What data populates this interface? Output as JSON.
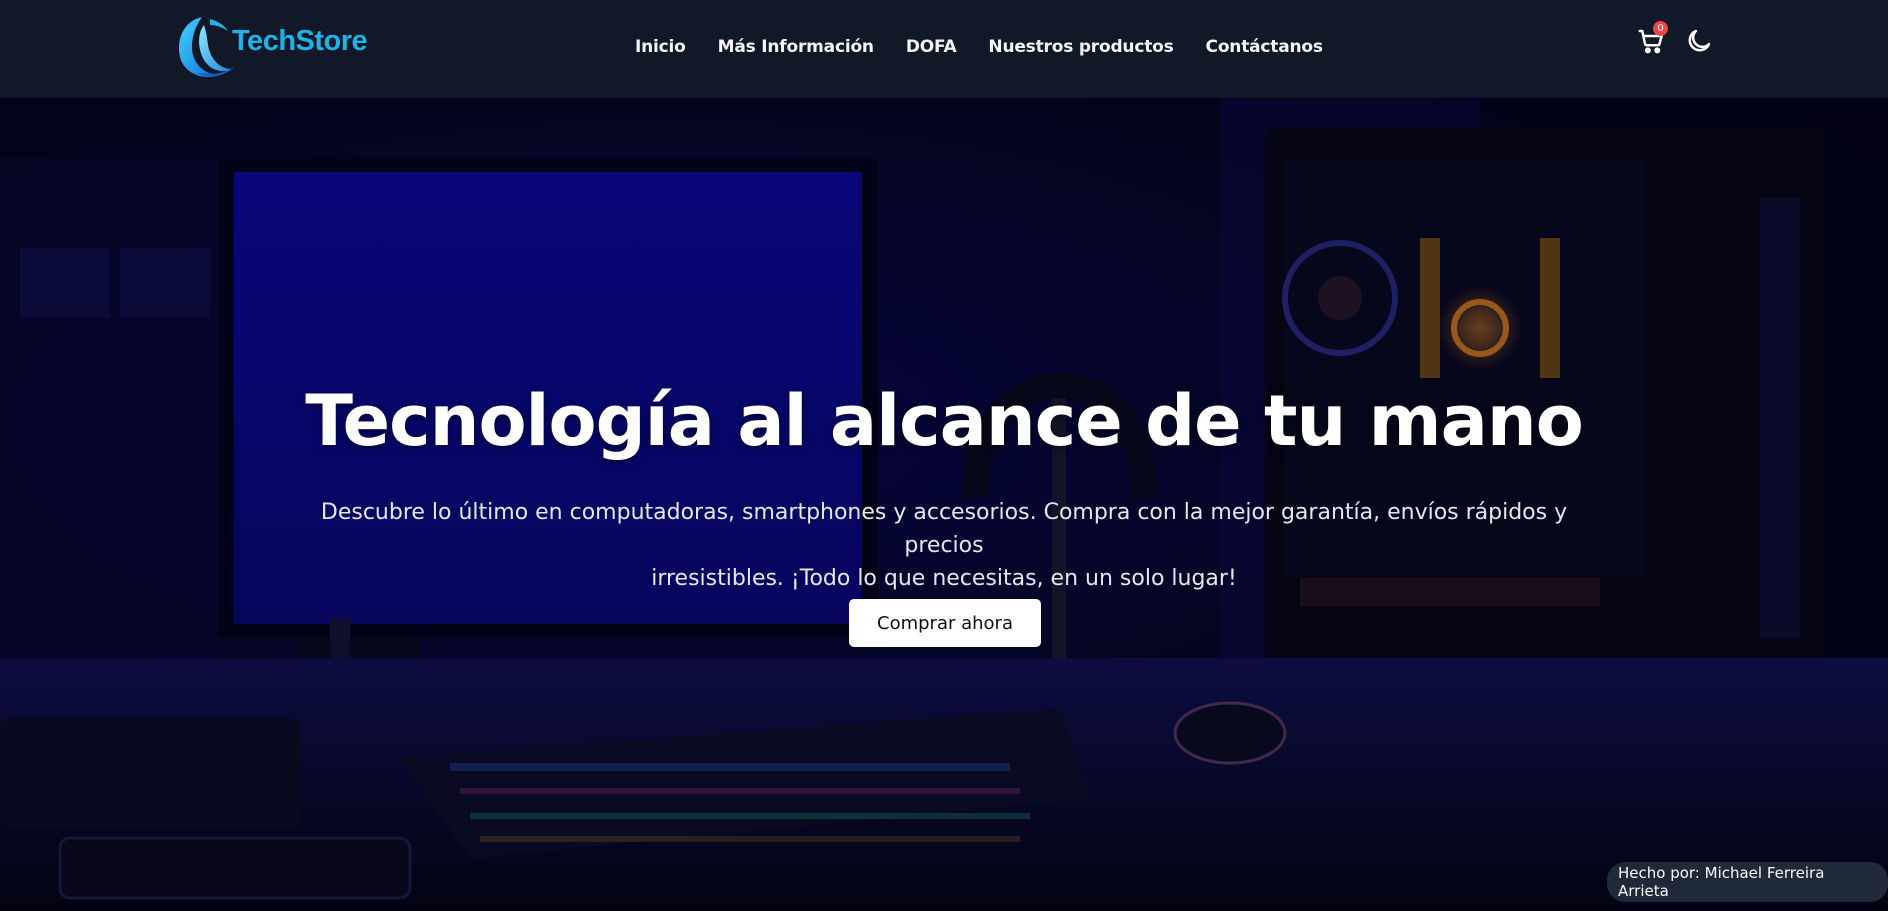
{
  "brand": {
    "name": "TechStore"
  },
  "nav": {
    "links": [
      "Inicio",
      "Más Información",
      "DOFA",
      "Nuestros productos",
      "Contáctanos"
    ]
  },
  "cart": {
    "count": "0",
    "icon": "cart-icon"
  },
  "theme_toggle": {
    "icon": "moon-icon"
  },
  "hero": {
    "title": "Tecnología al alcance de tu mano",
    "subtitle_line1": "Descubre lo último en computadoras, smartphones y accesorios. Compra con la mejor garantía, envíos rápidos y precios",
    "subtitle_line2": "irresistibles. ¡Todo lo que necesitas, en un solo lugar!",
    "cta_label": "Comprar ahora"
  },
  "footer_badge": {
    "text": "Hecho por: Michael Ferreira Arrieta"
  },
  "colors": {
    "navbar": "#111827",
    "brand": "#1fb3e8",
    "badge": "#ef4444",
    "cta_bg": "#ffffff"
  }
}
